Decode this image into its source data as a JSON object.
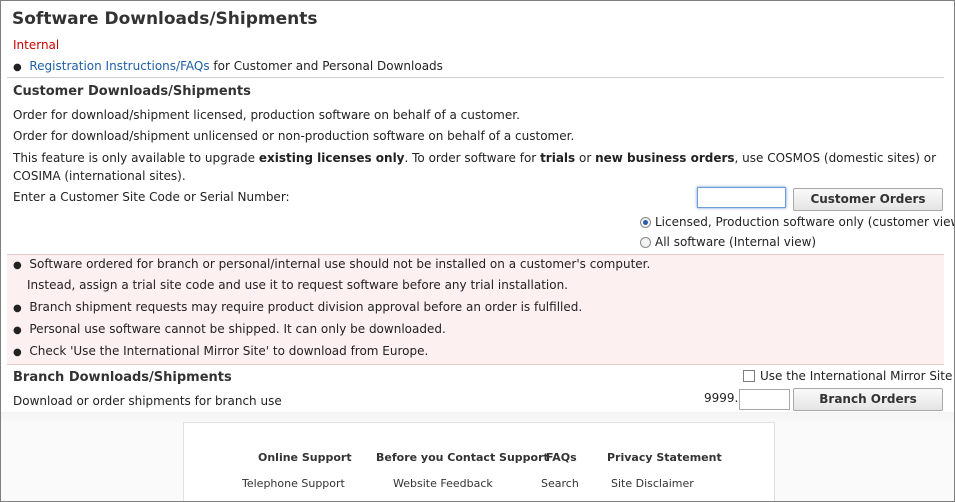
{
  "header": {
    "title": "Software Downloads/Shipments",
    "internal_label": "Internal"
  },
  "registration": {
    "link_text": "Registration Instructions/FAQs",
    "suffix_text": " for Customer and Personal Downloads"
  },
  "customer": {
    "title": "Customer Downloads/Shipments",
    "line1": "Order for download/shipment licensed, production software on behalf of a customer.",
    "line2": "Order for download/shipment unlicensed or non-production software on behalf of a customer.",
    "feature": {
      "t1": "This feature is only available to upgrade ",
      "b1": "existing licenses only",
      "t2": ". To order software for ",
      "b2": "trials",
      "t3": " or ",
      "b3": "new business orders",
      "t4": ", use COSMOS (domestic sites) or COSIMA (international sites)."
    },
    "site_code_label": "Enter a Customer Site Code or Serial Number:",
    "site_code_value": "",
    "orders_button": "Customer Orders",
    "radio_licensed": "Licensed, Production software only (customer view)",
    "radio_all": "All software (Internal view)",
    "selected_view": "licensed"
  },
  "warnings": {
    "items": [
      "Software ordered for branch or personal/internal use should not be installed on a customer's computer.",
      "Branch shipment requests may require product division approval before an order is fulfilled.",
      "Personal use software cannot be shipped. It can only be downloaded.",
      "Check 'Use the International Mirror Site' to download from Europe."
    ],
    "item1_continuation": "Instead, assign a trial site code and use it to request software before any trial installation."
  },
  "branch": {
    "title": "Branch Downloads/Shipments",
    "description": "Download or order shipments for branch use",
    "mirror_label": "Use the International Mirror Site",
    "mirror_checked": false,
    "code_prefix": "9999.",
    "code_value": "",
    "orders_button": "Branch Orders"
  },
  "footer": {
    "col1_head": "Online Support",
    "col1_link": "Telephone Support",
    "col2_head": "Before you Contact Support",
    "col2_link": "Website Feedback",
    "col3_head": "FAQs",
    "col3_link": "Search",
    "col4_head": "Privacy Statement",
    "col4_link": "Site Disclaimer"
  },
  "colors": {
    "internal_red": "#cc0000",
    "link_blue": "#1f5fa8",
    "warning_bg": "#fdf0f0"
  }
}
